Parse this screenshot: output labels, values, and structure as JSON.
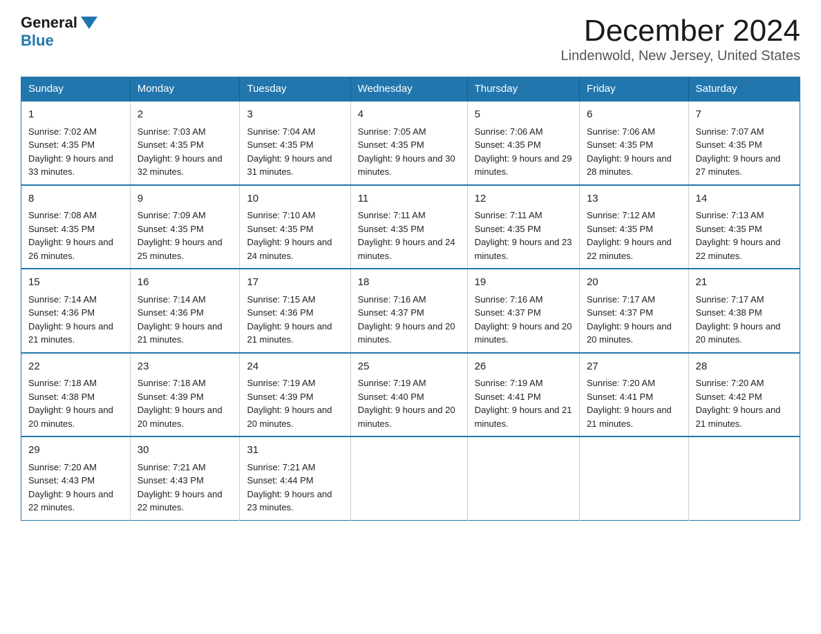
{
  "header": {
    "logo_general": "General",
    "logo_blue": "Blue",
    "month_year": "December 2024",
    "location": "Lindenwold, New Jersey, United States"
  },
  "days_of_week": [
    "Sunday",
    "Monday",
    "Tuesday",
    "Wednesday",
    "Thursday",
    "Friday",
    "Saturday"
  ],
  "weeks": [
    [
      {
        "day": "1",
        "sunrise": "7:02 AM",
        "sunset": "4:35 PM",
        "daylight": "9 hours and 33 minutes."
      },
      {
        "day": "2",
        "sunrise": "7:03 AM",
        "sunset": "4:35 PM",
        "daylight": "9 hours and 32 minutes."
      },
      {
        "day": "3",
        "sunrise": "7:04 AM",
        "sunset": "4:35 PM",
        "daylight": "9 hours and 31 minutes."
      },
      {
        "day": "4",
        "sunrise": "7:05 AM",
        "sunset": "4:35 PM",
        "daylight": "9 hours and 30 minutes."
      },
      {
        "day": "5",
        "sunrise": "7:06 AM",
        "sunset": "4:35 PM",
        "daylight": "9 hours and 29 minutes."
      },
      {
        "day": "6",
        "sunrise": "7:06 AM",
        "sunset": "4:35 PM",
        "daylight": "9 hours and 28 minutes."
      },
      {
        "day": "7",
        "sunrise": "7:07 AM",
        "sunset": "4:35 PM",
        "daylight": "9 hours and 27 minutes."
      }
    ],
    [
      {
        "day": "8",
        "sunrise": "7:08 AM",
        "sunset": "4:35 PM",
        "daylight": "9 hours and 26 minutes."
      },
      {
        "day": "9",
        "sunrise": "7:09 AM",
        "sunset": "4:35 PM",
        "daylight": "9 hours and 25 minutes."
      },
      {
        "day": "10",
        "sunrise": "7:10 AM",
        "sunset": "4:35 PM",
        "daylight": "9 hours and 24 minutes."
      },
      {
        "day": "11",
        "sunrise": "7:11 AM",
        "sunset": "4:35 PM",
        "daylight": "9 hours and 24 minutes."
      },
      {
        "day": "12",
        "sunrise": "7:11 AM",
        "sunset": "4:35 PM",
        "daylight": "9 hours and 23 minutes."
      },
      {
        "day": "13",
        "sunrise": "7:12 AM",
        "sunset": "4:35 PM",
        "daylight": "9 hours and 22 minutes."
      },
      {
        "day": "14",
        "sunrise": "7:13 AM",
        "sunset": "4:35 PM",
        "daylight": "9 hours and 22 minutes."
      }
    ],
    [
      {
        "day": "15",
        "sunrise": "7:14 AM",
        "sunset": "4:36 PM",
        "daylight": "9 hours and 21 minutes."
      },
      {
        "day": "16",
        "sunrise": "7:14 AM",
        "sunset": "4:36 PM",
        "daylight": "9 hours and 21 minutes."
      },
      {
        "day": "17",
        "sunrise": "7:15 AM",
        "sunset": "4:36 PM",
        "daylight": "9 hours and 21 minutes."
      },
      {
        "day": "18",
        "sunrise": "7:16 AM",
        "sunset": "4:37 PM",
        "daylight": "9 hours and 20 minutes."
      },
      {
        "day": "19",
        "sunrise": "7:16 AM",
        "sunset": "4:37 PM",
        "daylight": "9 hours and 20 minutes."
      },
      {
        "day": "20",
        "sunrise": "7:17 AM",
        "sunset": "4:37 PM",
        "daylight": "9 hours and 20 minutes."
      },
      {
        "day": "21",
        "sunrise": "7:17 AM",
        "sunset": "4:38 PM",
        "daylight": "9 hours and 20 minutes."
      }
    ],
    [
      {
        "day": "22",
        "sunrise": "7:18 AM",
        "sunset": "4:38 PM",
        "daylight": "9 hours and 20 minutes."
      },
      {
        "day": "23",
        "sunrise": "7:18 AM",
        "sunset": "4:39 PM",
        "daylight": "9 hours and 20 minutes."
      },
      {
        "day": "24",
        "sunrise": "7:19 AM",
        "sunset": "4:39 PM",
        "daylight": "9 hours and 20 minutes."
      },
      {
        "day": "25",
        "sunrise": "7:19 AM",
        "sunset": "4:40 PM",
        "daylight": "9 hours and 20 minutes."
      },
      {
        "day": "26",
        "sunrise": "7:19 AM",
        "sunset": "4:41 PM",
        "daylight": "9 hours and 21 minutes."
      },
      {
        "day": "27",
        "sunrise": "7:20 AM",
        "sunset": "4:41 PM",
        "daylight": "9 hours and 21 minutes."
      },
      {
        "day": "28",
        "sunrise": "7:20 AM",
        "sunset": "4:42 PM",
        "daylight": "9 hours and 21 minutes."
      }
    ],
    [
      {
        "day": "29",
        "sunrise": "7:20 AM",
        "sunset": "4:43 PM",
        "daylight": "9 hours and 22 minutes."
      },
      {
        "day": "30",
        "sunrise": "7:21 AM",
        "sunset": "4:43 PM",
        "daylight": "9 hours and 22 minutes."
      },
      {
        "day": "31",
        "sunrise": "7:21 AM",
        "sunset": "4:44 PM",
        "daylight": "9 hours and 23 minutes."
      },
      {
        "day": "",
        "sunrise": "",
        "sunset": "",
        "daylight": ""
      },
      {
        "day": "",
        "sunrise": "",
        "sunset": "",
        "daylight": ""
      },
      {
        "day": "",
        "sunrise": "",
        "sunset": "",
        "daylight": ""
      },
      {
        "day": "",
        "sunrise": "",
        "sunset": "",
        "daylight": ""
      }
    ]
  ]
}
